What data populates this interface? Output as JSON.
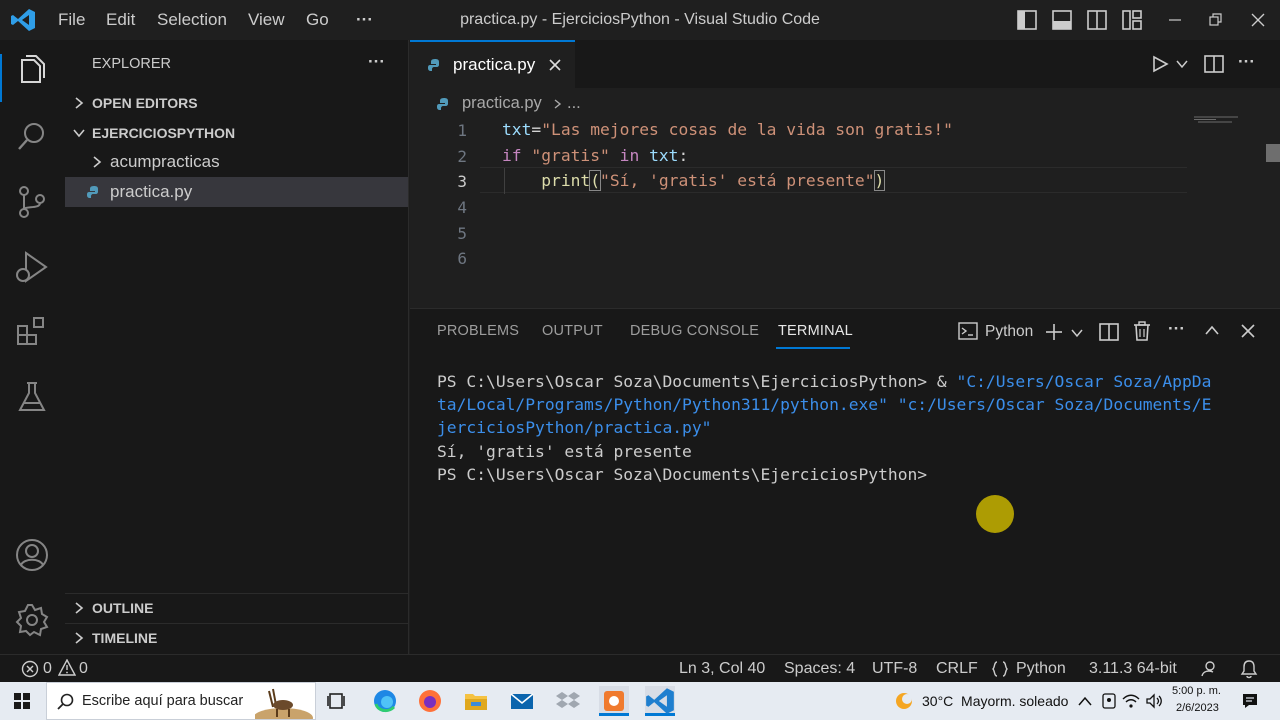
{
  "titlebar": {
    "menu": [
      "File",
      "Edit",
      "Selection",
      "View",
      "Go"
    ],
    "more": "···",
    "window_title": "practica.py - EjerciciosPython - Visual Studio Code",
    "controls": [
      "toggle-primary-sidebar-icon",
      "toggle-panel-icon",
      "toggle-secondary-sidebar-icon",
      "customize-layout-icon",
      "minimize-icon",
      "restore-icon",
      "close-icon"
    ]
  },
  "activitybar": [
    "explorer-icon",
    "search-icon",
    "source-control-icon",
    "run-debug-icon",
    "extensions-icon",
    "testing-icon",
    "accounts-icon",
    "manage-gear-icon"
  ],
  "sidebar": {
    "title": "EXPLORER",
    "more": "···",
    "open_editors": "OPEN EDITORS",
    "folder": "EJERCICIOSPYTHON",
    "items": [
      {
        "label": "acumpracticas",
        "type": "folder"
      },
      {
        "label": "practica.py",
        "type": "python-file",
        "selected": true
      }
    ],
    "outline": "OUTLINE",
    "timeline": "TIMELINE"
  },
  "editor": {
    "tab_label": "practica.py",
    "breadcrumb_file": "practica.py",
    "breadcrumb_more": "...",
    "line_numbers": [
      "1",
      "2",
      "3",
      "4",
      "5",
      "6"
    ],
    "active_line": 3,
    "code": {
      "l1_var": "txt",
      "l1_op": "=",
      "l1_str": "\"Las mejores cosas de la vida son gratis!\"",
      "l2_if": "if",
      "l2_str": "\"gratis\"",
      "l2_in": "in",
      "l2_var": "txt",
      "l2_colon": ":",
      "l3_fn": "print",
      "l3_open": "(",
      "l3_str": "\"Sí, 'gratis' está presente\"",
      "l3_close": ")"
    }
  },
  "panel": {
    "tabs": [
      "PROBLEMS",
      "OUTPUT",
      "DEBUG CONSOLE",
      "TERMINAL"
    ],
    "active_tab": "TERMINAL",
    "terminal_name": "Python",
    "terminal": {
      "l1_prompt": "PS C:\\Users\\Oscar Soza\\Documents\\EjerciciosPython> & ",
      "l1_path": "\"C:/Users/Oscar Soza/AppDa",
      "l2_path": "ta/Local/Programs/Python/Python311/python.exe\" \"c:/Users/Oscar Soza/Documents/E",
      "l3_path": "jerciciosPython/practica.py\"",
      "l4_output": "Sí, 'gratis' está presente",
      "l5_prompt": "PS C:\\Users\\Oscar Soza\\Documents\\EjerciciosPython>"
    }
  },
  "statusbar": {
    "errors": "0",
    "warnings": "0",
    "position": "Ln 3, Col 40",
    "spaces": "Spaces: 4",
    "encoding": "UTF-8",
    "eol": "CRLF",
    "language": "Python",
    "interpreter": "3.11.3 64-bit"
  },
  "taskbar": {
    "search_placeholder": "Escribe aquí para buscar",
    "weather": "30°C  Mayorm. soleado",
    "time": "5:00 p. m.",
    "date": "2/6/2023"
  },
  "colors": {
    "accent": "#0078d4",
    "cursor_highlight": "#c8b400"
  }
}
